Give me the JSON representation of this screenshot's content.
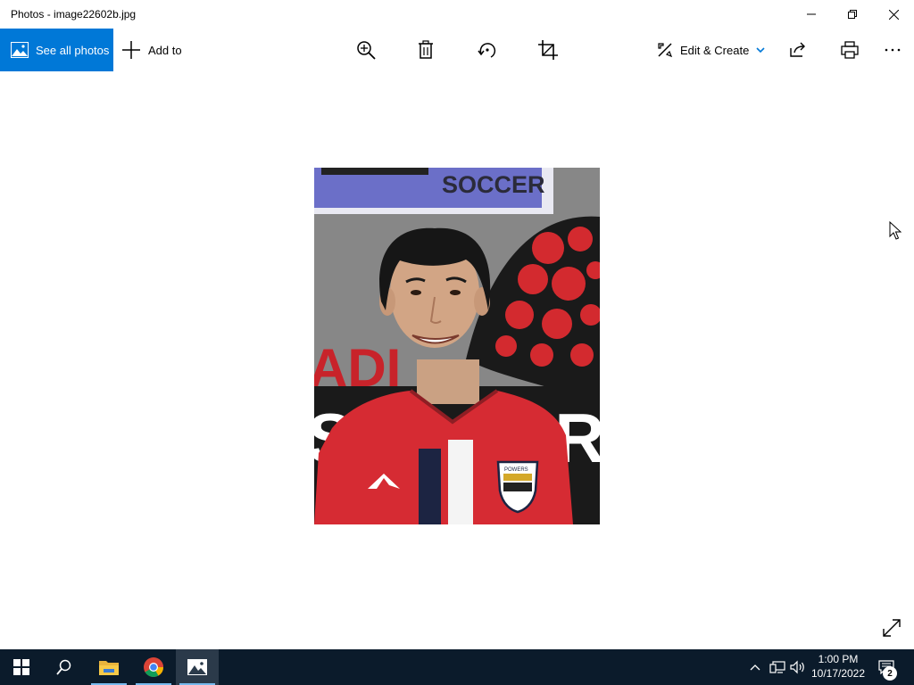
{
  "window": {
    "title": "Photos - image22602b.jpg",
    "minimize_icon": "minimize-icon",
    "restore_icon": "restore-icon",
    "close_icon": "close-icon"
  },
  "toolbar": {
    "see_all_photos": "See all photos",
    "add_to": "Add to",
    "zoom_icon": "zoom-in-icon",
    "delete_icon": "delete-icon",
    "rotate_icon": "rotate-icon",
    "crop_icon": "crop-icon",
    "edit_create": "Edit & Create",
    "share_icon": "share-icon",
    "print_icon": "print-icon",
    "more_icon": "more-icon"
  },
  "photo": {
    "poster_text": "SOCCER",
    "background_text": "SOCCER",
    "crest_text": "POWERS"
  },
  "taskbar": {
    "time": "1:00 PM",
    "date": "10/17/2022",
    "notification_count": "2"
  },
  "colors": {
    "accent": "#0078d7",
    "taskbar": "#0b1b2b",
    "jersey_red": "#d62b33",
    "wall_gray": "#878787"
  }
}
